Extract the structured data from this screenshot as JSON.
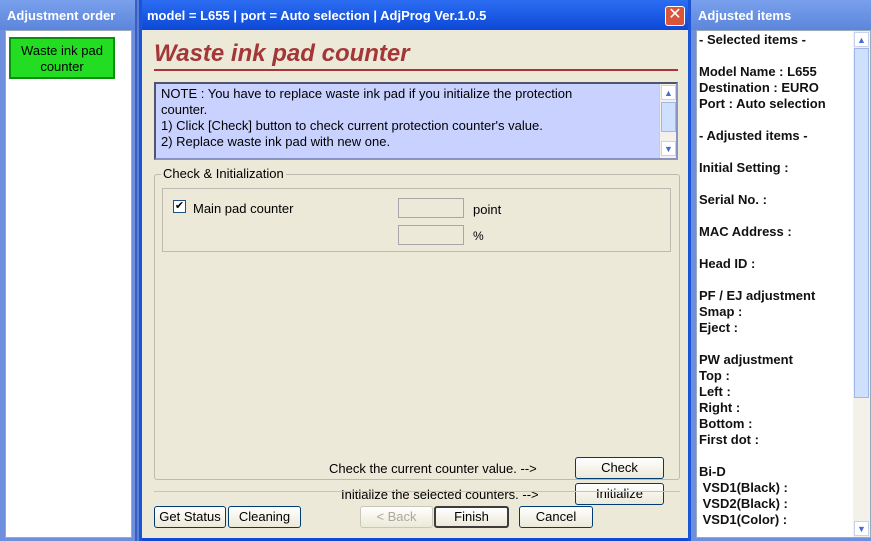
{
  "left_pane": {
    "title": "Adjustment order",
    "items": [
      {
        "label": "Waste ink pad counter",
        "active": true
      }
    ]
  },
  "window": {
    "title": "model = L655  |  port = Auto selection  |  AdjProg Ver.1.0.5",
    "close_glyph": "✕"
  },
  "main": {
    "heading": "Waste ink pad counter",
    "note_lines": [
      "NOTE : You have to replace waste ink pad if you initialize the protection",
      "counter.",
      "1) Click [Check] button to check current protection counter's value.",
      "2) Replace waste ink pad with new one."
    ],
    "group_title": "Check & Initialization",
    "counter": {
      "checked": true,
      "label": "Main pad counter",
      "point_value": "",
      "point_unit": "point",
      "percent_value": "",
      "percent_unit": "%"
    },
    "check_prompt": "Check the current counter value.  -->",
    "check_button": "Check",
    "init_prompt": "Initialize the selected counters.  -->",
    "init_button": "Initialize",
    "bottom_buttons": {
      "get_status": "Get Status",
      "cleaning": "Cleaning",
      "back": "< Back",
      "finish": "Finish",
      "cancel": "Cancel"
    }
  },
  "right_pane": {
    "title": "Adjusted items",
    "lines": [
      "- Selected items -",
      "",
      "Model Name : L655",
      "Destination : EURO",
      "Port : Auto selection",
      "",
      "- Adjusted items -",
      "",
      "Initial Setting :",
      "",
      "Serial No. :",
      "",
      "MAC Address :",
      "",
      "Head ID :",
      "",
      "PF / EJ adjustment",
      "Smap :",
      "Eject :",
      "",
      "PW adjustment",
      "Top :",
      "Left :",
      "Right :",
      "Bottom :",
      "First dot :",
      "",
      "Bi-D",
      " VSD1(Black) :",
      " VSD2(Black) :",
      " VSD1(Color) :"
    ]
  },
  "colors": {
    "active_item": "#22dd22",
    "heading": "#a33737",
    "note_bg": "#c9d2ff",
    "titlebar": "#0c48d6"
  }
}
